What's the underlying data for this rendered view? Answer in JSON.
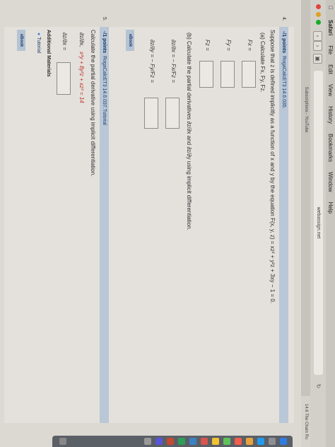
{
  "menubar": {
    "app": "Safari",
    "items": [
      "File",
      "Edit",
      "View",
      "History",
      "Bookmarks",
      "Window",
      "Help"
    ]
  },
  "browser": {
    "url": "webassign.net",
    "tabs": [
      "Subscriptions - YouTube",
      "14.6 The Chain Ru"
    ]
  },
  "q4": {
    "number": "4.",
    "points": "-/1 points",
    "ref": "RogaCalcET3 14.6.035.",
    "prompt": "Suppose that z is defined implicitly as a function of x and y by the equation  F(x, y, z) = xz² + y²z + 3xy − 1 = 0.",
    "part_a": "(a) Calculate  Fx, Fy, Fz.",
    "fx": "Fx =",
    "fy": "Fy =",
    "fz": "Fz =",
    "part_b": "(b) Calculate the partial derivatives  ∂z/∂x  and  ∂z/∂y  using implicit differentiation.",
    "dzdx": "∂z/∂x = − Fx/Fz =",
    "dzdy": "∂z/∂y = − Fy/Fz =",
    "ebook": "eBook"
  },
  "q5": {
    "number": "5.",
    "points": "-/1 points",
    "ref": "RogaCalcET3 14.6.037.Tutorial",
    "prompt": "Calculate the partial derivative using implicit differentiation.",
    "target": "∂z/∂x,",
    "equation": "x²y + 8y²z + xz² = 14",
    "answer_label": "∂z/∂x =",
    "additional": "Additional Materials",
    "tutorial": "Tutorial",
    "ebook": "eBook"
  },
  "colors": {
    "header_bg": "#b9c7d6",
    "link": "#1c3d6e",
    "equation": "#c02f25"
  }
}
